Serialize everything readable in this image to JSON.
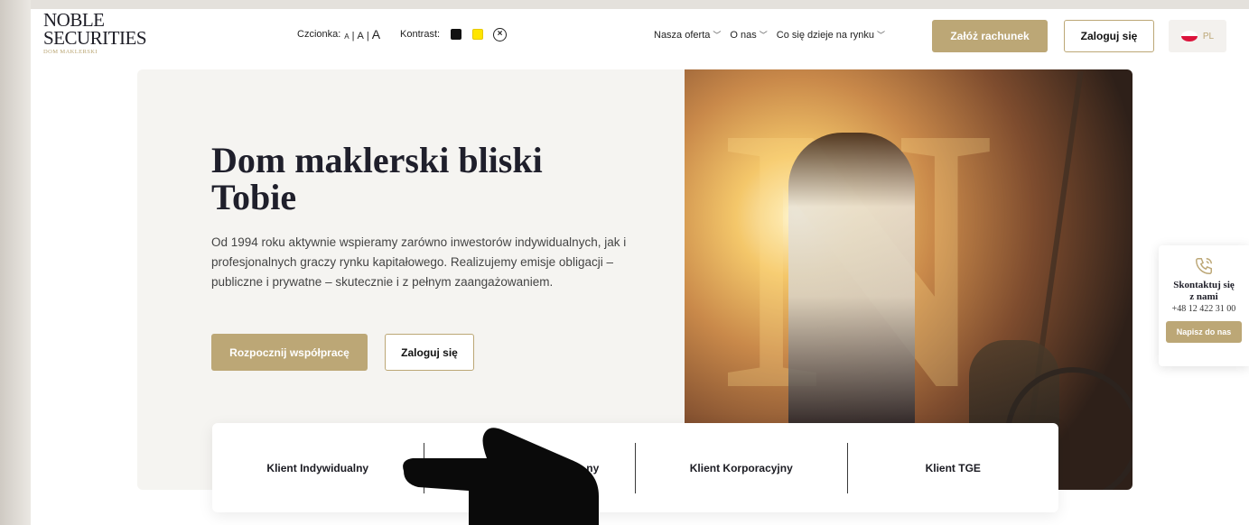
{
  "brand": {
    "line1": "NOBLE",
    "line2": "SECURITIES",
    "sub": "DOM MAKLERSKI"
  },
  "accessibility": {
    "font_label": "Czcionka:",
    "font_small": "A",
    "font_medium": "A",
    "font_large": "A",
    "sep": "|",
    "contrast_label": "Kontrast:"
  },
  "nav": [
    {
      "label": "Nasza oferta"
    },
    {
      "label": "O nas"
    },
    {
      "label": "Co się dzieje na rynku"
    }
  ],
  "header": {
    "open_account": "Załóż rachunek",
    "login": "Zaloguj się",
    "lang": "PL"
  },
  "hero": {
    "title": "Dom maklerski bliski Tobie",
    "description": "Od 1994 roku aktywnie wspieramy zarówno inwestorów indywidualnych, jak i profesjonalnych graczy rynku kapitałowego. Realizujemy emisje obligacji – publiczne i prywatne – skutecznie i z pełnym zaangażowaniem.",
    "cta_primary": "Rozpocznij współpracę",
    "cta_secondary": "Zaloguj się",
    "photo_letter": "N"
  },
  "tabs": [
    {
      "label": "Klient Indywidualny"
    },
    {
      "label": "ny"
    },
    {
      "label": "Klient Korporacyjny"
    },
    {
      "label": "Klient TGE"
    }
  ],
  "contact": {
    "title_line1": "Skontaktuj się",
    "title_line2": "z nami",
    "phone": "+48 12 422 31 00",
    "button": "Napisz do nas"
  },
  "colors": {
    "accent": "#bca776",
    "text": "#1f1f2b",
    "hero_bg": "#f5f4f1"
  }
}
